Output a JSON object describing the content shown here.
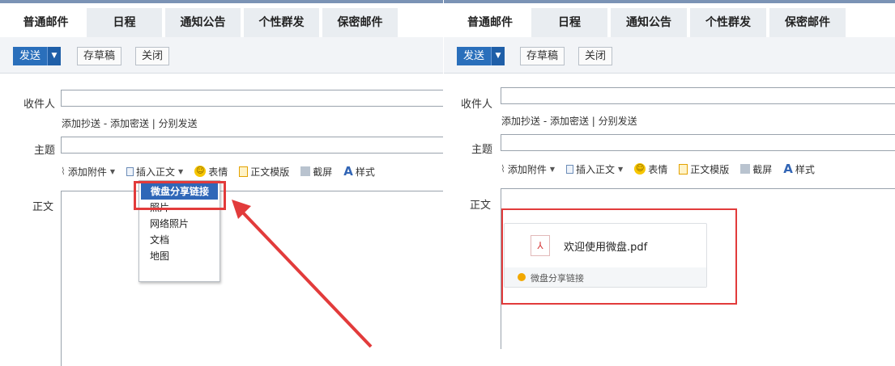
{
  "tabs": [
    "普通邮件",
    "日程",
    "通知公告",
    "个性群发",
    "保密邮件"
  ],
  "toolbar": {
    "send_label": "发送",
    "send_arrow": "▼",
    "draft_label": "存草稿",
    "close_label": "关闭"
  },
  "form": {
    "recipient_label": "收件人",
    "cc_links": "添加抄送 - 添加密送 | 分别发送",
    "subject_label": "主题",
    "body_label": "正文"
  },
  "options": {
    "attach": "添加附件",
    "insert_body": "插入正文",
    "emoji": "表情",
    "template": "正文模版",
    "screenshot": "截屏",
    "style": "样式",
    "dropdown_caret": "▼"
  },
  "dropdown": {
    "items": [
      "微盘分享链接",
      "照片",
      "网络照片",
      "文档",
      "地图"
    ]
  },
  "attachment_card": {
    "file_name": "欢迎使用微盘.pdf",
    "footer_text": "微盘分享链接"
  },
  "colors": {
    "accent_blue": "#2a6fbb",
    "highlight_red": "#e23b3b"
  }
}
